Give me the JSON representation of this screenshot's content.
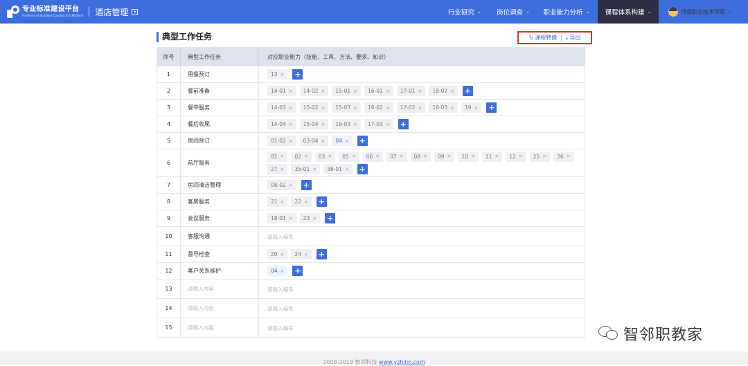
{
  "header": {
    "brand": "专业标准建设平台",
    "brand_sub": "Professional Standard Construction Platform",
    "module": "酒店管理",
    "nav": [
      {
        "label": "行业研究"
      },
      {
        "label": "岗位调查"
      },
      {
        "label": "职业能力分析"
      },
      {
        "label": "课程体系构建",
        "active": true
      }
    ],
    "user": "河南职业技术学院"
  },
  "section": {
    "title": "典型工作任务",
    "convert_label": "课程转换",
    "export_label": "导出"
  },
  "table": {
    "headers": [
      "序号",
      "典型工作任务",
      "对应职业能力（技能、工具、方法、要求、知识）"
    ],
    "task_placeholder": "请输入内容",
    "code_placeholder": "请输入编号",
    "rows": [
      {
        "no": "1",
        "task": "用餐预订",
        "tags": [
          "13"
        ]
      },
      {
        "no": "2",
        "task": "餐前准备",
        "tags": [
          "14-01",
          "14-02",
          "15-01",
          "16-01",
          "17-01",
          "18-02"
        ]
      },
      {
        "no": "3",
        "task": "餐中服务",
        "tags": [
          "14-03",
          "15-02",
          "15-03",
          "16-02",
          "17-02",
          "18-03",
          "19"
        ]
      },
      {
        "no": "4",
        "task": "餐后收尾",
        "tags": [
          "14-04",
          "15-04",
          "16-03",
          "17-03"
        ]
      },
      {
        "no": "5",
        "task": "房间预订",
        "tags": [
          "01-02",
          "03-04",
          "04"
        ],
        "highlight": [
          "04"
        ]
      },
      {
        "no": "6",
        "task": "前厅服务",
        "tags": [
          "01",
          "02",
          "03",
          "05",
          "06",
          "07",
          "08",
          "09",
          "10",
          "11",
          "12",
          "25",
          "26",
          "27",
          "35-01",
          "38-01"
        ]
      },
      {
        "no": "7",
        "task": "房间清洁整理",
        "tags": [
          "08-02"
        ]
      },
      {
        "no": "8",
        "task": "客房服务",
        "tags": [
          "21",
          "22"
        ]
      },
      {
        "no": "9",
        "task": "会议服务",
        "tags": [
          "18-01",
          "23"
        ]
      },
      {
        "no": "10",
        "task": "客服沟通",
        "tags": []
      },
      {
        "no": "11",
        "task": "督导检查",
        "tags": [
          "20",
          "24"
        ]
      },
      {
        "no": "12",
        "task": "客户关系维护",
        "tags": [
          "04"
        ],
        "highlight": [
          "04"
        ]
      },
      {
        "no": "13",
        "task": "",
        "tags": []
      },
      {
        "no": "14",
        "task": "",
        "tags": []
      },
      {
        "no": "15",
        "task": "",
        "tags": []
      }
    ]
  },
  "footer": {
    "copyright": "2008-2019 智邻科技 ",
    "link": "www.yzhilin.com"
  },
  "watermark": "智邻职教家",
  "colors": {
    "primary": "#3c6ee0",
    "nav_active": "#2e2f44",
    "highlight_border": "#e03030"
  }
}
